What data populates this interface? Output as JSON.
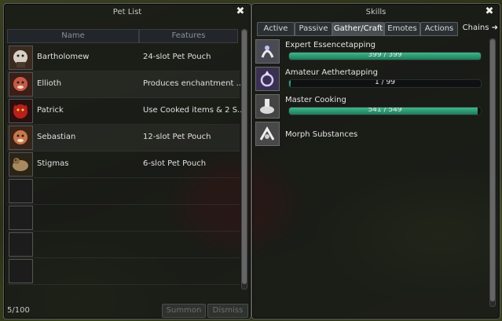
{
  "pet_list": {
    "title": "Pet List",
    "close": "✖",
    "columns": {
      "name": "Name",
      "features": "Features"
    },
    "pets": [
      {
        "name": "Bartholomew",
        "features": "24-slot Pet Pouch",
        "icon": "pet-avatar-icon"
      },
      {
        "name": "Ellioth",
        "features": "Produces enchantment ...",
        "icon": "pet-avatar-icon"
      },
      {
        "name": "Patrick",
        "features": "Use Cooked items & 2 S...",
        "icon": "pet-avatar-icon"
      },
      {
        "name": "Sebastian",
        "features": "12-slot Pet Pouch",
        "icon": "pet-avatar-icon"
      },
      {
        "name": "Stigmas",
        "features": "6-slot Pet Pouch",
        "icon": "pet-avatar-icon"
      }
    ],
    "count": "5/100",
    "summon_label": "Summon",
    "dismiss_label": "Dismiss"
  },
  "skills": {
    "title": "Skills",
    "close": "✖",
    "tabs": [
      "Active",
      "Passive",
      "Gather/Craft",
      "Emotes",
      "Actions"
    ],
    "active_tab": "Gather/Craft",
    "chains": "Chains ➜",
    "items": [
      {
        "name": "Expert Essencetapping",
        "progress": "399 / 399",
        "fill": 1.0
      },
      {
        "name": "Amateur Aethertapping",
        "progress": "1 / 99",
        "fill": 0.01
      },
      {
        "name": "Master Cooking",
        "progress": "541 / 549",
        "fill": 0.985
      },
      {
        "name": "Morph Substances",
        "progress": "",
        "fill": null
      }
    ]
  },
  "colors": {
    "bar_fill": "#2fa07a",
    "window_bg": "#141616",
    "accent_border": "#5c5c5c"
  }
}
